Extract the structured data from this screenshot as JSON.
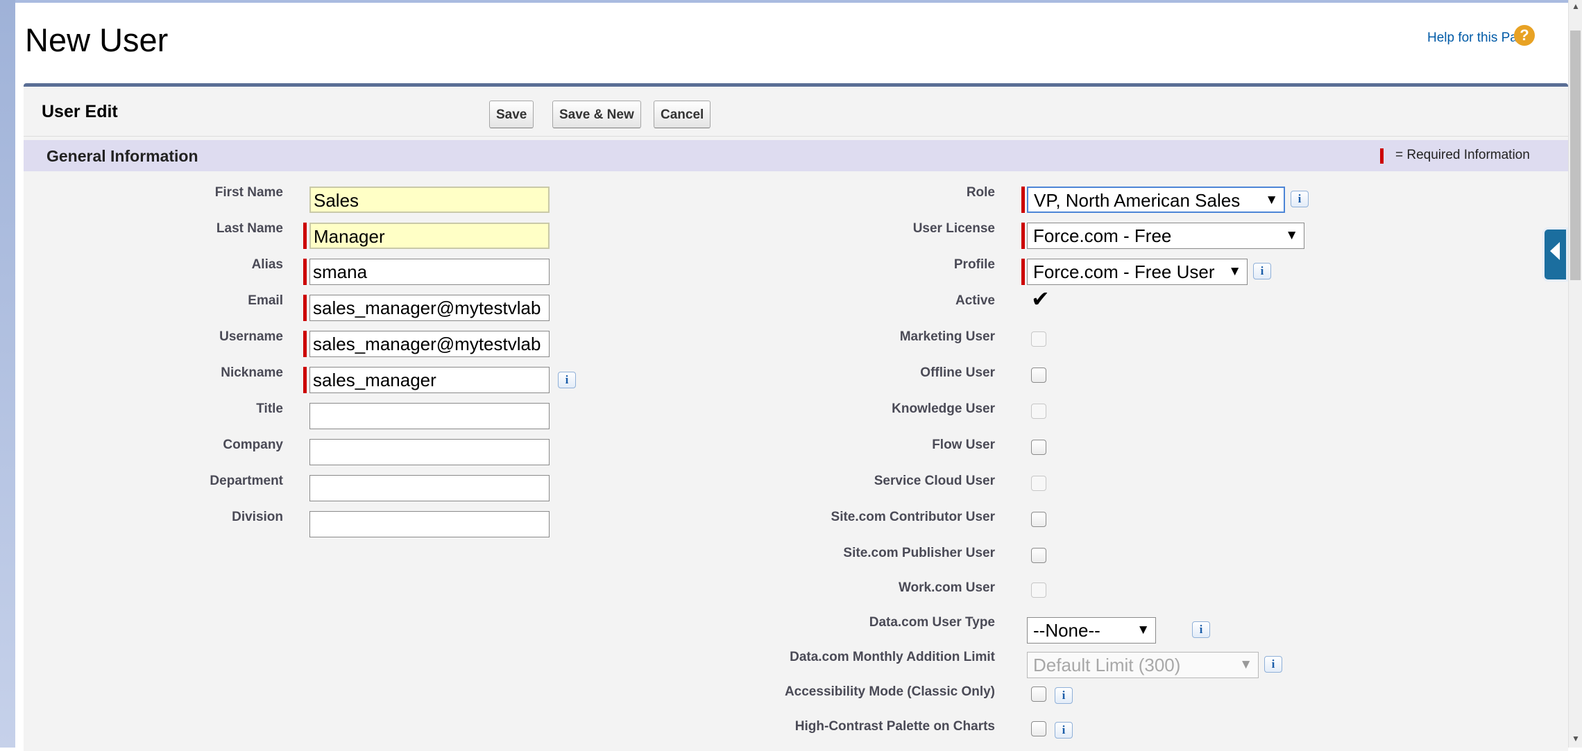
{
  "page": {
    "title": "New User",
    "help_link": "Help for this Page",
    "help_icon": "question-circle-icon"
  },
  "form": {
    "title": "User Edit",
    "buttons": {
      "save": "Save",
      "save_new": "Save & New",
      "cancel": "Cancel"
    },
    "section_title": "General Information",
    "required_legend": "= Required Information",
    "colors": {
      "required": "#cc0000",
      "header_bar": "#dedcf0",
      "panel_border": "#5a6e95",
      "highlight_input": "#ffffc6"
    }
  },
  "left_fields": [
    {
      "label": "First Name",
      "value": "Sales",
      "required": false,
      "highlighted": true
    },
    {
      "label": "Last Name",
      "value": "Manager",
      "required": true,
      "highlighted": true
    },
    {
      "label": "Alias",
      "value": "smana",
      "required": true
    },
    {
      "label": "Email",
      "value": "sales_manager@mytestvlab",
      "required": true
    },
    {
      "label": "Username",
      "value": "sales_manager@mytestvlab",
      "required": true
    },
    {
      "label": "Nickname",
      "value": "sales_manager",
      "required": true,
      "info": true
    },
    {
      "label": "Title",
      "value": ""
    },
    {
      "label": "Company",
      "value": ""
    },
    {
      "label": "Department",
      "value": ""
    },
    {
      "label": "Division",
      "value": ""
    }
  ],
  "right_fields": {
    "role": {
      "label": "Role",
      "value": "VP, North American Sales"
    },
    "user_license": {
      "label": "User License",
      "value": "Force.com - Free"
    },
    "profile": {
      "label": "Profile",
      "value": "Force.com - Free User"
    },
    "active": {
      "label": "Active",
      "checked": true
    },
    "marketing_user": {
      "label": "Marketing User",
      "checked": false,
      "disabled": true
    },
    "offline_user": {
      "label": "Offline User",
      "checked": false
    },
    "knowledge_user": {
      "label": "Knowledge User",
      "checked": false,
      "disabled": true
    },
    "flow_user": {
      "label": "Flow User",
      "checked": false
    },
    "service_cloud_user": {
      "label": "Service Cloud User",
      "checked": false,
      "disabled": true
    },
    "site_contributor_user": {
      "label": "Site.com Contributor User",
      "checked": false
    },
    "site_publisher_user": {
      "label": "Site.com Publisher User",
      "checked": false
    },
    "work_user": {
      "label": "Work.com User",
      "checked": false,
      "disabled": true
    },
    "datacom_user_type": {
      "label": "Data.com User Type",
      "value": "--None--"
    },
    "datacom_limit": {
      "label": "Data.com Monthly Addition Limit",
      "value": "Default Limit (300)",
      "disabled": true
    },
    "accessibility_mode": {
      "label": "Accessibility Mode (Classic Only)",
      "checked": false
    },
    "high_contrast": {
      "label": "High-Contrast Palette on Charts",
      "checked": false
    }
  },
  "icons": {
    "info": "i",
    "check": "✔",
    "caret": "▼",
    "side_tab": "chevron-left-icon"
  }
}
